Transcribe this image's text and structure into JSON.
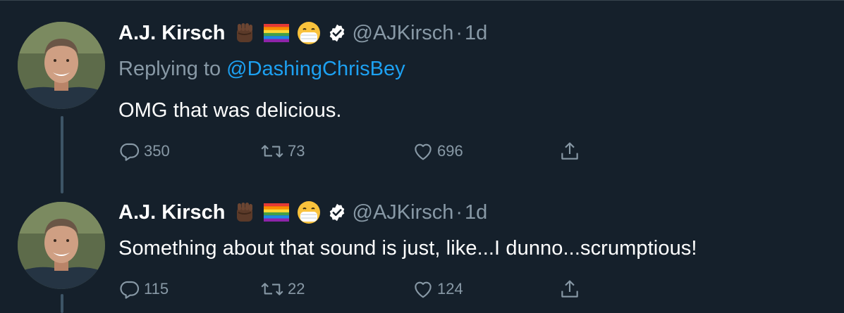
{
  "tweets": [
    {
      "author": {
        "name": "A.J. Kirsch",
        "emojis": [
          "raised-fist-dark-skin-emoji",
          "rainbow-flag-emoji",
          "face-with-medical-mask-emoji"
        ],
        "handle": "@AJKirsch",
        "verified": true
      },
      "separator": "·",
      "time": "1d",
      "replying_to": {
        "prefix": "Replying to ",
        "mention": "@DashingChrisBey"
      },
      "text": "OMG that was delicious.",
      "stats": {
        "replies": "350",
        "retweets": "73",
        "likes": "696"
      }
    },
    {
      "author": {
        "name": "A.J. Kirsch",
        "emojis": [
          "raised-fist-dark-skin-emoji",
          "rainbow-flag-emoji",
          "face-with-medical-mask-emoji"
        ],
        "handle": "@AJKirsch",
        "verified": true
      },
      "separator": "·",
      "time": "1d",
      "text": "Something about that sound is just, like...I dunno...scrumptious!",
      "stats": {
        "replies": "115",
        "retweets": "22",
        "likes": "124"
      }
    }
  ],
  "colors": {
    "background": "#15202b",
    "primary_text": "#ffffff",
    "secondary_text": "#8899a6",
    "link": "#1da1f2",
    "thread_line": "#3d5466",
    "border": "#38444d"
  }
}
